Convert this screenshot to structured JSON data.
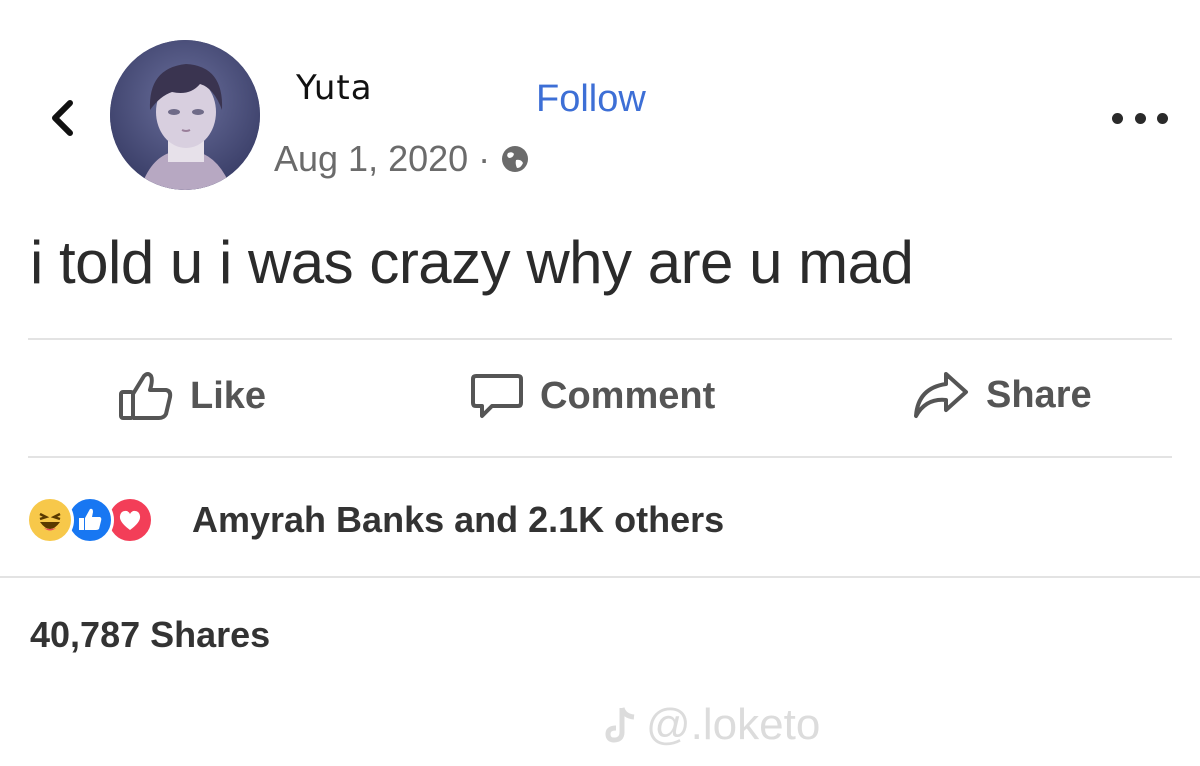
{
  "post": {
    "author": "Yuta",
    "follow_label": "Follow",
    "date": "Aug 1, 2020",
    "separator": "·",
    "text": "i told u i was crazy why are u mad"
  },
  "actions": {
    "like": "Like",
    "comment": "Comment",
    "share": "Share"
  },
  "reactions": {
    "summary": "Amyrah Banks and 2.1K others",
    "icons": [
      "haha-icon",
      "like-reaction-icon",
      "love-icon"
    ]
  },
  "shares": {
    "count_label": "40,787 Shares"
  },
  "watermark": {
    "text": "@.loketo"
  },
  "colors": {
    "link_blue": "#3d6fd6",
    "like_blue": "#1877f2",
    "love_red": "#f33e58",
    "haha_yellow": "#f7c84a"
  }
}
